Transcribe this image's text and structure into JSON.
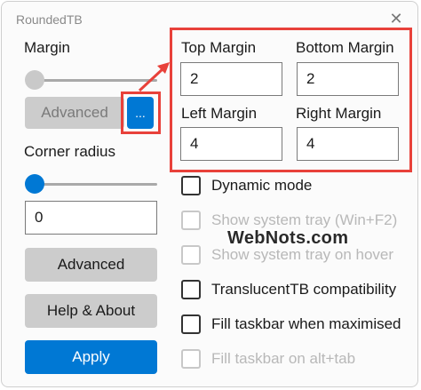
{
  "window": {
    "title": "RoundedTB",
    "close_glyph": "✕"
  },
  "margin": {
    "label": "Margin",
    "slider_value": 0,
    "advanced_label": "Advanced",
    "more_label": "..."
  },
  "corner_radius": {
    "label": "Corner radius",
    "slider_value": 0,
    "value": "0"
  },
  "advanced_margins": {
    "top": {
      "label": "Top Margin",
      "value": "2"
    },
    "bottom": {
      "label": "Bottom Margin",
      "value": "2"
    },
    "left": {
      "label": "Left Margin",
      "value": "4"
    },
    "right": {
      "label": "Right Margin",
      "value": "4"
    }
  },
  "options": [
    {
      "label": "Dynamic mode",
      "enabled": true,
      "checked": false
    },
    {
      "label": "Show system tray (Win+F2)",
      "enabled": false,
      "checked": false
    },
    {
      "label": "Show system tray on hover",
      "enabled": false,
      "checked": false
    },
    {
      "label": "TranslucentTB compatibility",
      "enabled": true,
      "checked": false
    },
    {
      "label": "Fill taskbar when maximised",
      "enabled": true,
      "checked": false
    },
    {
      "label": "Fill taskbar on alt+tab",
      "enabled": false,
      "checked": false
    }
  ],
  "buttons": {
    "advanced": "Advanced",
    "help": "Help & About",
    "apply": "Apply"
  },
  "watermark": "WebNots.com",
  "colors": {
    "accent": "#0078d4",
    "highlight": "#e8413a"
  }
}
